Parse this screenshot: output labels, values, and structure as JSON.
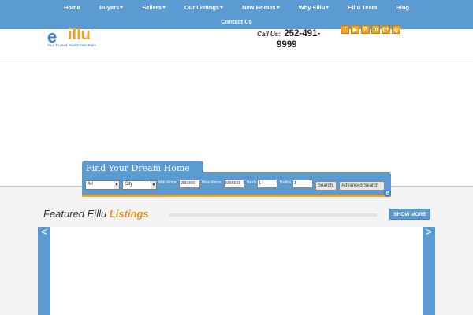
{
  "nav": {
    "row1": [
      {
        "label": "Home",
        "caret": false
      },
      {
        "label": "Buyers",
        "caret": true
      },
      {
        "label": "Sellers",
        "caret": true
      },
      {
        "label": "Our Listings",
        "caret": true
      },
      {
        "label": "New Homes",
        "caret": true
      },
      {
        "label": "Why Eillu",
        "caret": true
      },
      {
        "label": "Eillu Team",
        "caret": false
      },
      {
        "label": "Blog",
        "caret": false
      }
    ],
    "row2": [
      {
        "label": "Contact Us",
        "caret": false
      }
    ]
  },
  "header": {
    "logo_mark": "e",
    "logo_word": "illu",
    "logo_tagline": "Your Trusted Real Estate Team",
    "call_label": "Call Us:",
    "call_number_line1": "252-491-",
    "call_number_line2": "9999",
    "social": [
      "f",
      "▶",
      "P",
      "in",
      "g+",
      "◎"
    ]
  },
  "search": {
    "title": "Find Your Dream Home",
    "type_select": "All",
    "city_select": "City",
    "min_price_label": "Min Price",
    "min_price_value": "200000",
    "max_price_label": "Max Price",
    "max_price_value": "600000",
    "beds_label": "Beds",
    "beds_value": "1",
    "baths_label": "Baths",
    "baths_value": "1",
    "search_button": "Search",
    "advanced_button": "Advanced Search",
    "badge": "e"
  },
  "featured": {
    "title_prefix": "Featured Eillu ",
    "title_highlight": "Listings",
    "show_more": "SHOW MORE",
    "prev": "<",
    "next": ">"
  },
  "colors": {
    "primary_blue": "#5b9bd1",
    "accent_orange": "#f2a21f"
  }
}
